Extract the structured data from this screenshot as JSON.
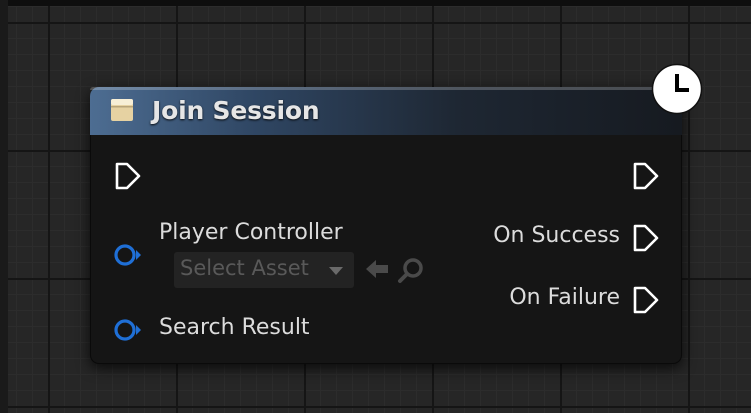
{
  "node": {
    "title": "Join Session",
    "header_color": "#3f5c7e",
    "latent_icon": "clock-icon"
  },
  "inputs": [
    {
      "type": "exec",
      "label": ""
    },
    {
      "type": "object",
      "label": "Player Controller",
      "color": "#1f6fd6"
    },
    {
      "type": "object",
      "label": "Search Result",
      "color": "#1f6fd6"
    }
  ],
  "outputs": [
    {
      "type": "exec",
      "label": ""
    },
    {
      "type": "exec",
      "label": "On Success"
    },
    {
      "type": "exec",
      "label": "On Failure"
    }
  ],
  "asset_picker": {
    "value": "Select Asset",
    "icons": [
      "dropdown-arrow-icon",
      "use-selected-arrow-icon",
      "browse-magnifier-icon"
    ]
  }
}
